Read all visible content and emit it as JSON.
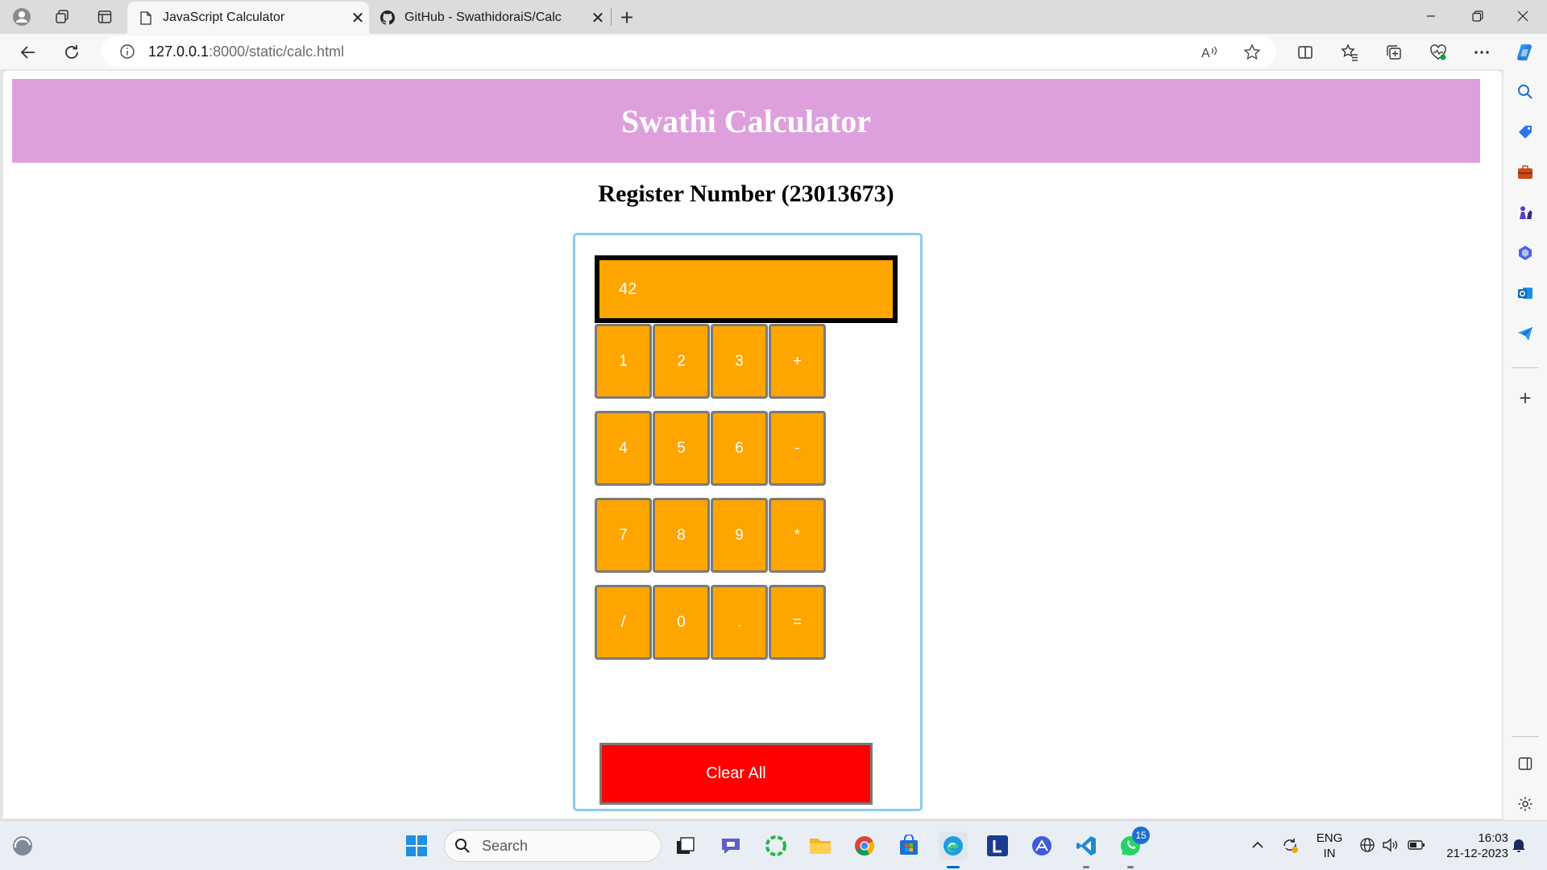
{
  "browser": {
    "tabs": [
      {
        "title": "JavaScript Calculator",
        "active": true,
        "favicon": "page-icon"
      },
      {
        "title": "GitHub - SwathidoraiS/Calc",
        "active": false,
        "favicon": "github-icon"
      }
    ],
    "address": {
      "host": "127.0.0.1",
      "path": ":8000/static/calc.html"
    }
  },
  "page": {
    "banner_title": "Swathi Calculator",
    "subtitle": "Register Number (23013673)",
    "display_value": "42",
    "keys": [
      "1",
      "2",
      "3",
      "+",
      "4",
      "5",
      "6",
      "-",
      "7",
      "8",
      "9",
      "*",
      "/",
      "0",
      ".",
      "="
    ],
    "clear_label": "Clear All",
    "colors": {
      "banner": "#dda0dd",
      "key": "#ffa500",
      "clear": "#ff0000",
      "calc_border": "#87ceeb"
    }
  },
  "taskbar": {
    "search_label": "Search",
    "whatsapp_badge": "15",
    "lang_line1": "ENG",
    "lang_line2": "IN",
    "time": "16:03",
    "date": "21-12-2023"
  }
}
